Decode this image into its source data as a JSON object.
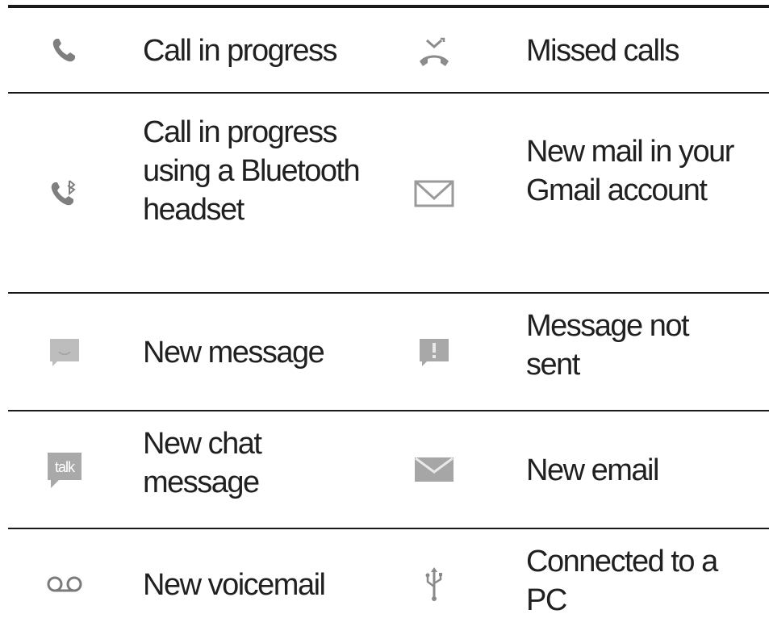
{
  "rows": [
    {
      "left": {
        "icon": "phone-icon",
        "label": "Call in progress"
      },
      "right": {
        "icon": "missed-call-icon",
        "label": "Missed calls"
      }
    },
    {
      "left": {
        "icon": "bluetooth-call-icon",
        "label": "Call in progress using a Bluetooth headset"
      },
      "right": {
        "icon": "gmail-icon",
        "label": "New mail in your Gmail account"
      }
    },
    {
      "left": {
        "icon": "message-icon",
        "label": "New message"
      },
      "right": {
        "icon": "message-error-icon",
        "label": "Message not sent"
      }
    },
    {
      "left": {
        "icon": "talk-chat-icon",
        "label": "New chat message",
        "icon_text": "talk"
      },
      "right": {
        "icon": "email-icon",
        "label": "New email"
      }
    },
    {
      "left": {
        "icon": "voicemail-icon",
        "label": "New voicemail"
      },
      "right": {
        "icon": "usb-icon",
        "label": "Connected to a PC"
      }
    }
  ],
  "colors": {
    "icon": "#8a8a8a",
    "icon_light": "#b5b5b5",
    "rule": "#1a1a1a",
    "text": "#202020"
  }
}
